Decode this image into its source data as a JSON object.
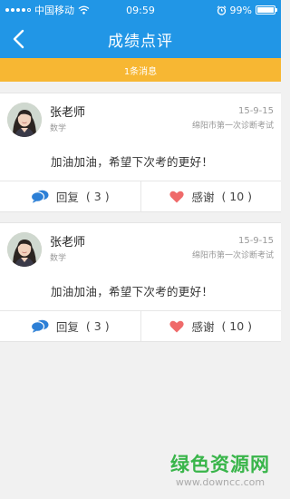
{
  "status": {
    "carrier": "中国移动",
    "time": "09:59",
    "battery": "99%",
    "battery_level": 0.99,
    "icons": [
      "signal-dots-icon",
      "wifi-icon",
      "alarm-icon",
      "battery-icon"
    ]
  },
  "nav": {
    "title": "成绩点评",
    "back_icon": "chevron-left-icon"
  },
  "notice": {
    "text": "1条消息"
  },
  "comments": [
    {
      "teacher": "张老师",
      "subject": "数学",
      "date": "15-9-15",
      "exam": "绵阳市第一次诊断考试",
      "text": "加油加油，希望下次考的更好！",
      "reply_label": "回复",
      "reply_count": "( 3 )",
      "thanks_label": "感谢",
      "thanks_count": "( 10 )"
    },
    {
      "teacher": "张老师",
      "subject": "数学",
      "date": "15-9-15",
      "exam": "绵阳市第一次诊断考试",
      "text": "加油加油，希望下次考的更好！",
      "reply_label": "回复",
      "reply_count": "( 3 )",
      "thanks_label": "感谢",
      "thanks_count": "( 10 )"
    }
  ],
  "watermark": {
    "main": "绿色资源网",
    "sub": "www.downcc.com"
  },
  "colors": {
    "primary": "#2196e6",
    "notice": "#f7b733",
    "reply_icon": "#2c7fd6",
    "heart_icon": "#ef6a6a",
    "watermark": "#39b54a"
  }
}
